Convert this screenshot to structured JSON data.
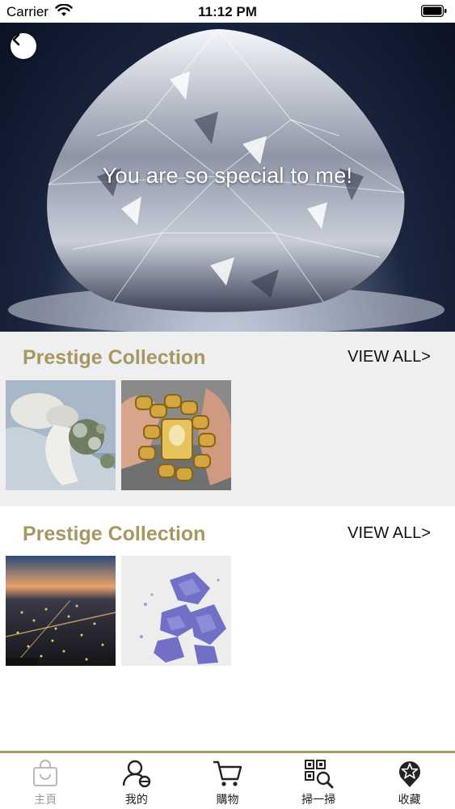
{
  "status_bar": {
    "carrier": "Carrier",
    "time": "11:12 PM"
  },
  "hero": {
    "caption": "You are so special to me!"
  },
  "sections": [
    {
      "title": "Prestige Collection",
      "view_all": "VIEW ALL>"
    },
    {
      "title": "Prestige Collection",
      "view_all": "VIEW ALL>"
    }
  ],
  "tabs": [
    {
      "label": "主頁",
      "icon": "shopping-bag-icon",
      "active": true
    },
    {
      "label": "我的",
      "icon": "user-icon",
      "active": false
    },
    {
      "label": "購物",
      "icon": "cart-icon",
      "active": false
    },
    {
      "label": "掃一掃",
      "icon": "qr-scan-icon",
      "active": false
    },
    {
      "label": "收藏",
      "icon": "star-badge-icon",
      "active": false
    }
  ],
  "colors": {
    "accent": "#a79761",
    "section_bg": "#efeff1",
    "inactive_tab": "#9b9b9b"
  }
}
